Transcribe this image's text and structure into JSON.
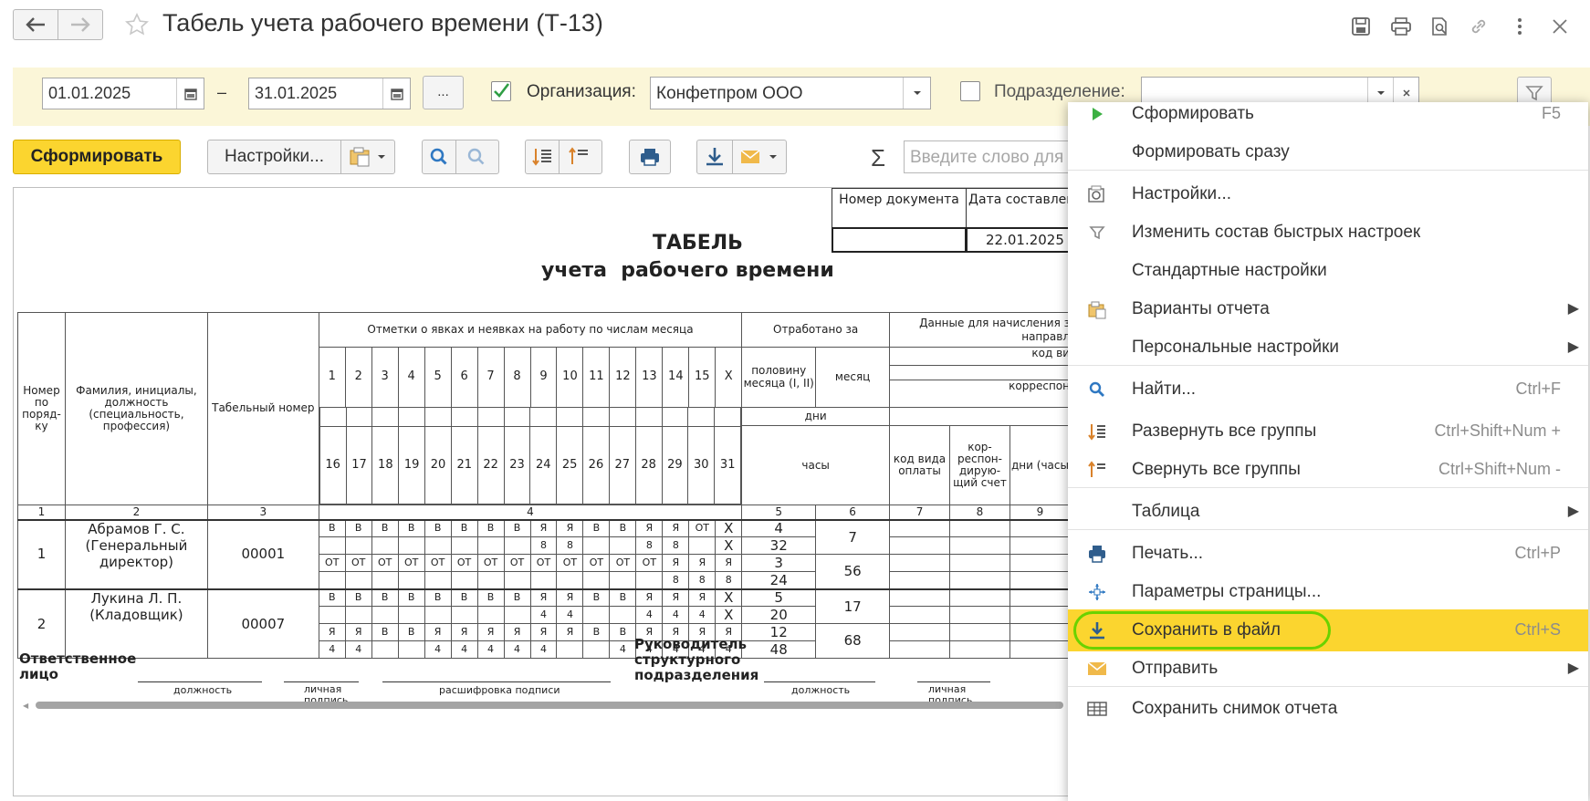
{
  "window": {
    "title": "Табель учета рабочего времени (Т-13)"
  },
  "filters": {
    "date_from": "01.01.2025",
    "date_dash": "–",
    "date_to": "31.01.2025",
    "more_label": "...",
    "org_label": "Организация:",
    "org_value": "Конфетпром ООО",
    "dept_label": "Подразделение:",
    "dept_value": ""
  },
  "toolbar": {
    "generate_label": "Сформировать",
    "settings_label": "Настройки...",
    "sigma": "Σ",
    "search_placeholder": "Введите слово для"
  },
  "report": {
    "doc_number_header": "Номер документа",
    "date_header": "Дата составления",
    "date_value": "22.01.2025",
    "title_line1": "ТАБЕЛЬ",
    "title_line2": "учета  рабочего времени",
    "headers": {
      "num": "Номер по поряд-ку",
      "fio": "Фамилия, инициалы, должность (специальность, профессия)",
      "tab": "Табельный номер",
      "marks": "Отметки о явках и неявках на работу по числам месяца",
      "worked": "Отработано за",
      "half": "половину месяца (I, II)",
      "month": "месяц",
      "days": "дни",
      "hours": "часы",
      "payroll": "Данные для начисления з",
      "payroll_dir": "направл",
      "code_kind": "код ви",
      "corresp": "корреспон",
      "pay_code": "код вида оплаты",
      "corr_acc": "кор-респон-дирую-щий счет",
      "days_hours": "дни (часы"
    },
    "days_first": [
      "1",
      "2",
      "3",
      "4",
      "5",
      "6",
      "7",
      "8",
      "9",
      "10",
      "11",
      "12",
      "13",
      "14",
      "15",
      "X"
    ],
    "days_second": [
      "16",
      "17",
      "18",
      "19",
      "20",
      "21",
      "22",
      "23",
      "24",
      "25",
      "26",
      "27",
      "28",
      "29",
      "30",
      "31"
    ],
    "col_numbers": [
      "1",
      "2",
      "3",
      "4",
      "5",
      "6",
      "7",
      "8",
      "9"
    ],
    "rows": [
      {
        "num": "1",
        "name": "Абрамов Г. С. (Генеральный директор)",
        "tab": "00001",
        "r1": [
          "В",
          "В",
          "В",
          "В",
          "В",
          "В",
          "В",
          "В",
          "Я",
          "Я",
          "В",
          "В",
          "Я",
          "Я",
          "ОТ",
          "X"
        ],
        "r2": [
          "",
          "",
          "",
          "",
          "",
          "",
          "",
          "",
          "8",
          "8",
          "",
          "",
          "8",
          "8",
          "",
          "X"
        ],
        "r3": [
          "ОТ",
          "ОТ",
          "ОТ",
          "ОТ",
          "ОТ",
          "ОТ",
          "ОТ",
          "ОТ",
          "ОТ",
          "ОТ",
          "ОТ",
          "ОТ",
          "ОТ",
          "Я",
          "Я",
          "Я"
        ],
        "r4": [
          "",
          "",
          "",
          "",
          "",
          "",
          "",
          "",
          "",
          "",
          "",
          "",
          "",
          "8",
          "8",
          "8"
        ],
        "half1_days": "4",
        "half1_hours": "32",
        "half2_days": "3",
        "half2_hours": "24",
        "month_days": "7",
        "month_hours": "56"
      },
      {
        "num": "2",
        "name": "Лукина Л. П. (Кладовщик)",
        "tab": "00007",
        "r1": [
          "В",
          "В",
          "В",
          "В",
          "В",
          "В",
          "В",
          "В",
          "Я",
          "Я",
          "В",
          "В",
          "Я",
          "Я",
          "Я",
          "X"
        ],
        "r2": [
          "",
          "",
          "",
          "",
          "",
          "",
          "",
          "",
          "4",
          "4",
          "",
          "",
          "4",
          "4",
          "4",
          "X"
        ],
        "r3": [
          "Я",
          "Я",
          "В",
          "В",
          "Я",
          "Я",
          "Я",
          "Я",
          "Я",
          "Я",
          "В",
          "В",
          "Я",
          "Я",
          "Я",
          "Я"
        ],
        "r4": [
          "4",
          "4",
          "",
          "",
          "4",
          "4",
          "4",
          "4",
          "4",
          "",
          "",
          "4",
          "4",
          "4",
          "4",
          "4"
        ],
        "half1_days": "5",
        "half1_hours": "20",
        "half2_days": "12",
        "half2_hours": "48",
        "month_days": "17",
        "month_hours": "68"
      }
    ],
    "footer": {
      "responsible": "Ответственное лицо",
      "position": "должность",
      "signature": "личная подпись",
      "decode": "расшифровка подписи",
      "head": "Руководитель структурного подразделения",
      "position2": "должность",
      "signature2": "личная подпись"
    }
  },
  "menu": {
    "items": [
      {
        "label": "Сформировать",
        "shortcut": "F5"
      },
      {
        "label": "Формировать сразу",
        "shortcut": ""
      },
      {
        "label": "Настройки...",
        "shortcut": ""
      },
      {
        "label": "Изменить состав быстрых настроек",
        "shortcut": ""
      },
      {
        "label": "Стандартные настройки",
        "shortcut": ""
      },
      {
        "label": "Варианты отчета",
        "shortcut": ""
      },
      {
        "label": "Персональные настройки",
        "shortcut": ""
      },
      {
        "label": "Найти...",
        "shortcut": "Ctrl+F"
      },
      {
        "label": "Развернуть все группы",
        "shortcut": "Ctrl+Shift+Num +"
      },
      {
        "label": "Свернуть все группы",
        "shortcut": "Ctrl+Shift+Num -"
      },
      {
        "label": "Таблица",
        "shortcut": ""
      },
      {
        "label": "Печать...",
        "shortcut": "Ctrl+P"
      },
      {
        "label": "Параметры страницы...",
        "shortcut": ""
      },
      {
        "label": "Сохранить в файл",
        "shortcut": "Ctrl+S"
      },
      {
        "label": "Отправить",
        "shortcut": ""
      },
      {
        "label": "Сохранить снимок отчета",
        "shortcut": ""
      }
    ]
  },
  "colors": {
    "accent_yellow": "#fbd52f",
    "filter_bg": "#fbf6d8",
    "highlight_ring": "#6ad200",
    "play_green": "#3cb043",
    "icon_blue": "#2f78c2"
  }
}
